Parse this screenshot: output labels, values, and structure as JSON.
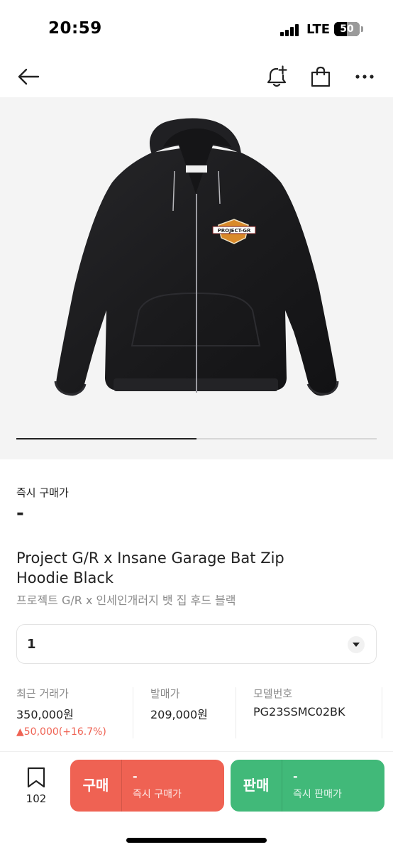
{
  "status_bar": {
    "time": "20:59",
    "carrier": "LTE",
    "battery": "50",
    "battery_level": 0.5
  },
  "nav": {
    "back_icon": "arrow-left-icon",
    "alert_icon": "bell-plus-icon",
    "bag_icon": "shopping-bag-icon",
    "more_icon": "more-dots-icon"
  },
  "hero": {
    "logo_text": "PROJECT-GR",
    "carousel_progress": 0.5
  },
  "product": {
    "instant_label": "즉시 구매가",
    "instant_value": "-",
    "name_en": "Project G/R x Insane Garage Bat Zip Hoodie Black",
    "name_ko": "프로젝트 G/R x 인세인개러지 뱃 집 후드 블랙"
  },
  "size_select": {
    "value": "1"
  },
  "stats": {
    "recent_label": "최근 거래가",
    "recent_value": "350,000원",
    "recent_change": "▲50,000(+16.7%)",
    "release_label": "발매가",
    "release_value": "209,000원",
    "model_label": "모델번호",
    "model_value": "PG23SSMC02BK"
  },
  "bottom_bar": {
    "wish_count": "102",
    "buy_label": "구매",
    "buy_price": "-",
    "buy_sub": "즉시 구매가",
    "sell_label": "판매",
    "sell_price": "-",
    "sell_sub": "즉시 판매가"
  },
  "colors": {
    "buy": "#ef6253",
    "sell": "#41b979",
    "price_up": "#ef6253"
  }
}
